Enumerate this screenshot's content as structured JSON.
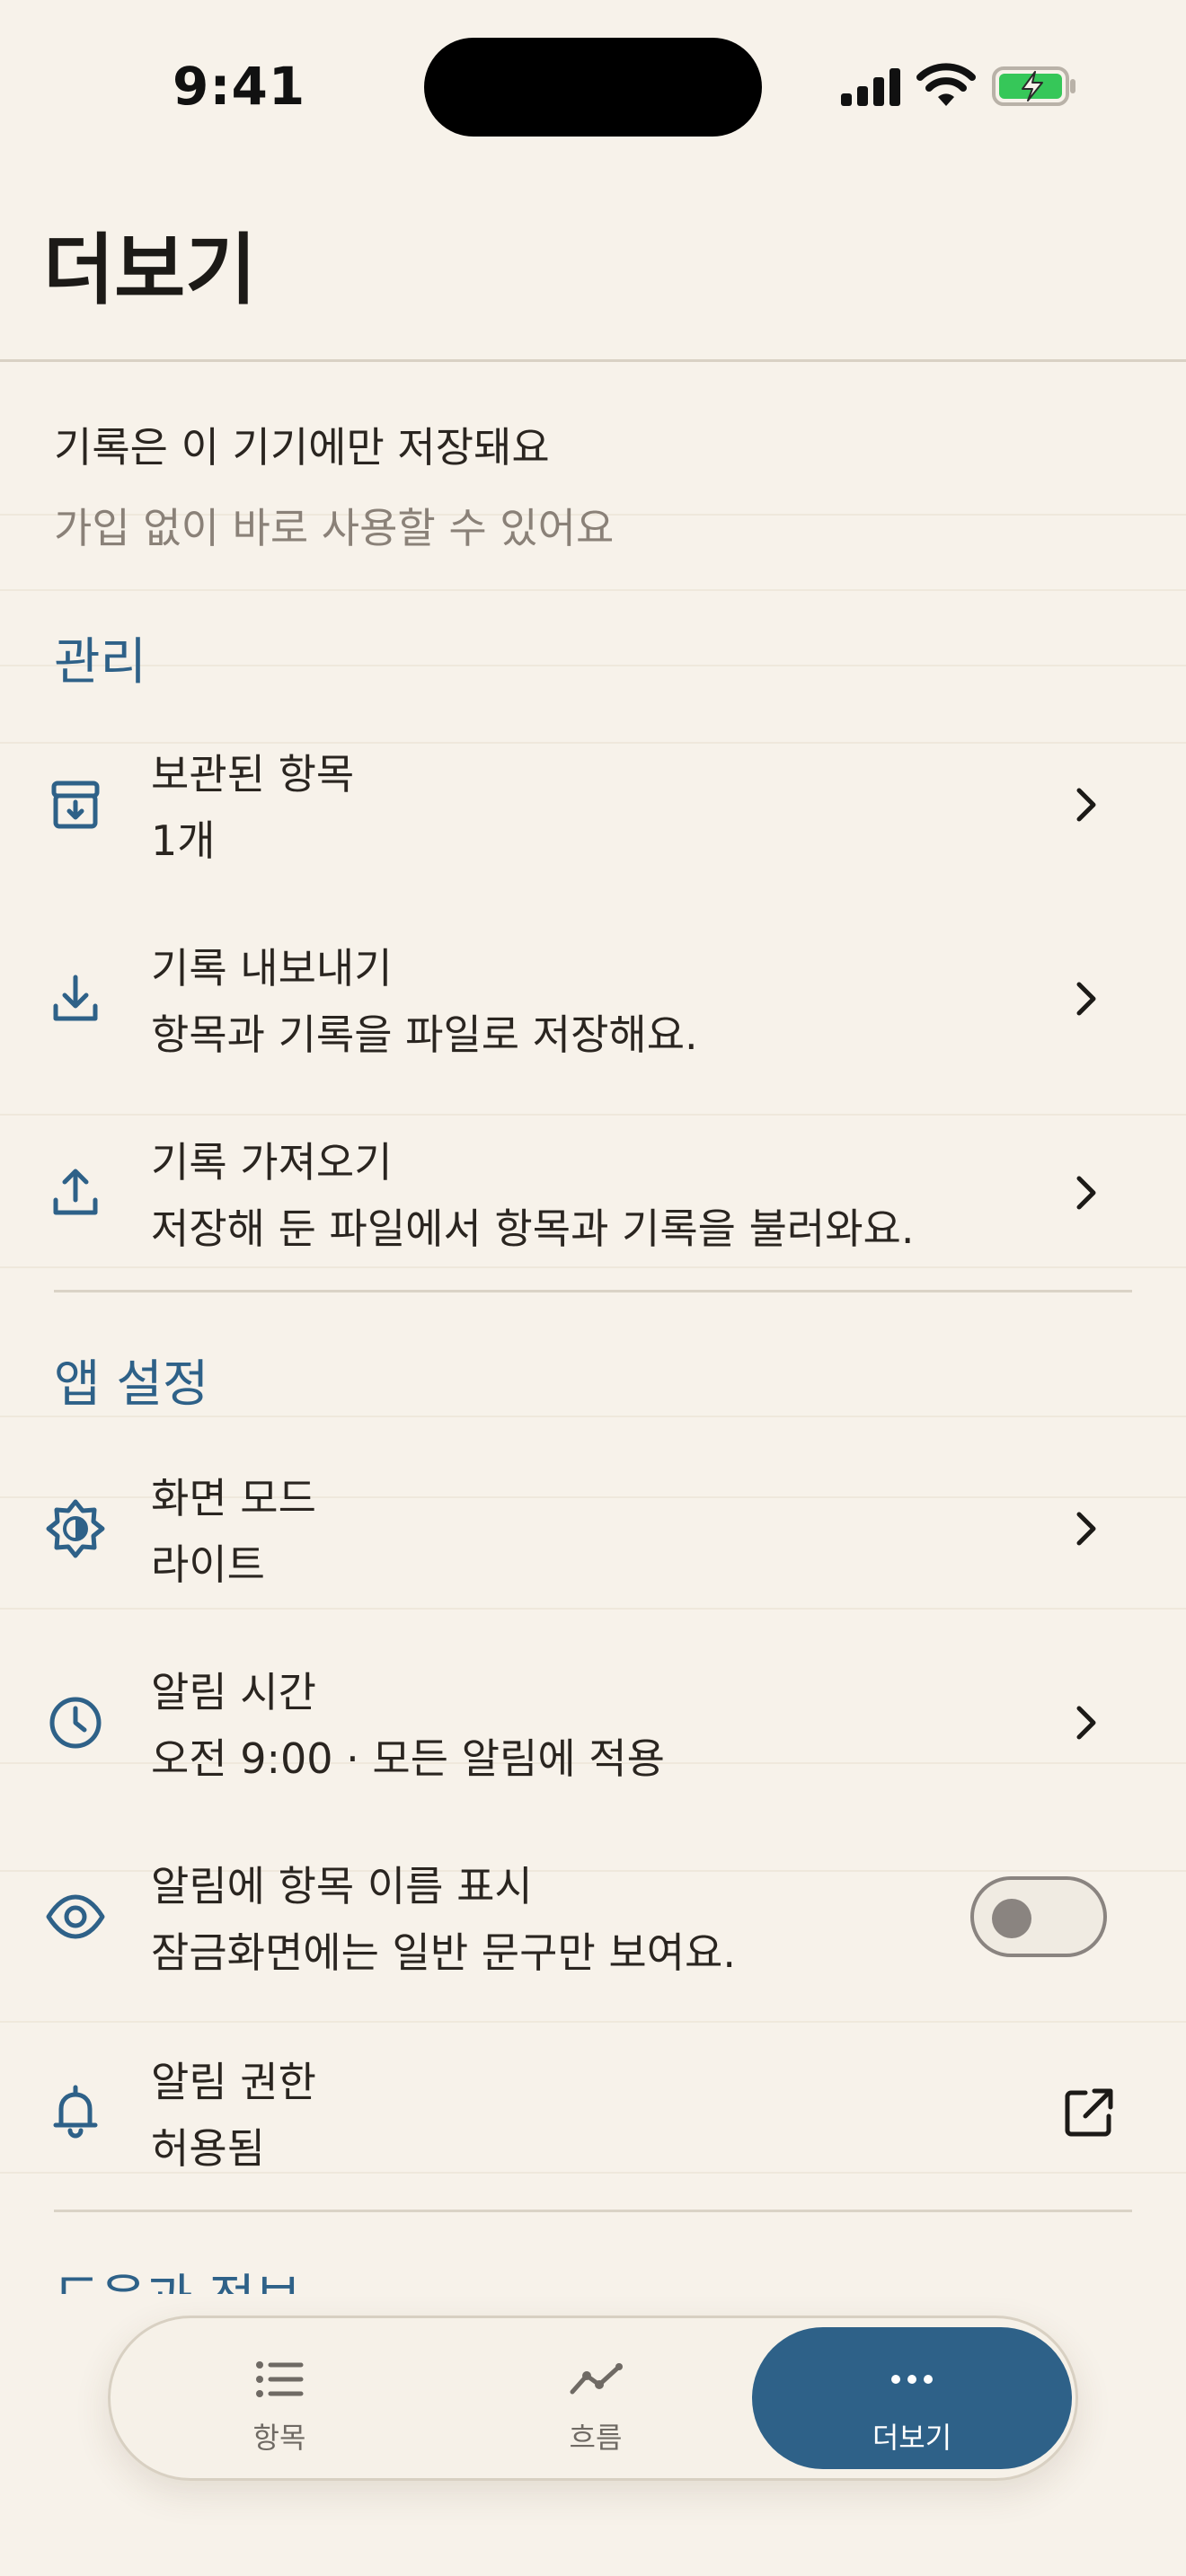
{
  "status_bar": {
    "time": "9:41"
  },
  "header": {
    "title": "더보기"
  },
  "intro": {
    "line1": "기록은 이 기기에만 저장돼요",
    "line2": "가입 없이 바로 사용할 수 있어요"
  },
  "sections": {
    "manage": {
      "title": "관리",
      "items": [
        {
          "title": "보관된 항목",
          "subtitle": "1개",
          "icon": "archive-icon"
        },
        {
          "title": "기록 내보내기",
          "subtitle": "항목과 기록을 파일로 저장해요.",
          "icon": "download-icon"
        },
        {
          "title": "기록 가져오기",
          "subtitle": "저장해 둔 파일에서 항목과 기록을 불러와요.",
          "icon": "upload-icon"
        }
      ]
    },
    "app_settings": {
      "title": "앱 설정",
      "items": [
        {
          "title": "화면 모드",
          "subtitle": "라이트",
          "icon": "brightness-icon"
        },
        {
          "title": "알림 시간",
          "subtitle": "오전 9:00 · 모든 알림에 적용",
          "icon": "clock-icon"
        },
        {
          "title": "알림에 항목 이름 표시",
          "subtitle": "잠금화면에는 일반 문구만 보여요.",
          "icon": "eye-icon",
          "toggle_on": false
        },
        {
          "title": "알림 권한",
          "subtitle": "허용됨",
          "icon": "bell-icon"
        }
      ]
    },
    "next_partial": {
      "title": "도움과 정보"
    }
  },
  "tabbar": {
    "tabs": [
      {
        "label": "항목",
        "icon": "list-icon"
      },
      {
        "label": "흐름",
        "icon": "trend-icon"
      },
      {
        "label": "더보기",
        "icon": "more-icon",
        "active": true
      }
    ]
  },
  "colors": {
    "accent": "#2e6188",
    "background": "#f7f2ea",
    "text": "#2a2520",
    "muted": "#8a8178"
  }
}
